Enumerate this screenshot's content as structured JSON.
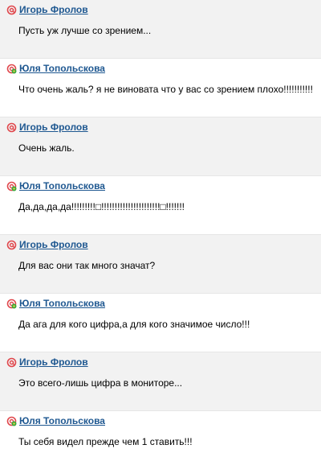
{
  "thread": {
    "messages": [
      {
        "author": "Игорь Фролов",
        "text": "Пусть уж лучше со зрением...",
        "status": "away-icon"
      },
      {
        "author": "Юля Топольскова",
        "text": "Что очень жаль? я не виновата что у вас со зрением плохо!!!!!!!!!!!",
        "status": "online-icon"
      },
      {
        "author": "Игорь Фролов",
        "text": "Очень жаль.",
        "status": "away-icon"
      },
      {
        "author": "Юля Топольскова",
        "text": "Да,да,да,да!!!!!!!!!□!!!!!!!!!!!!!!!!!!!!!!□!!!!!!!",
        "status": "online-icon"
      },
      {
        "author": "Игорь Фролов",
        "text": "Для вас они так много значат?",
        "status": "away-icon"
      },
      {
        "author": "Юля Топольскова",
        "text": "Да ага для кого цифра,а для кого значимое число!!!",
        "status": "online-icon"
      },
      {
        "author": "Игорь Фролов",
        "text": "Это всего-лишь цифра в мониторе...",
        "status": "away-icon"
      },
      {
        "author": "Юля Топольскова",
        "text": "Ты себя видел прежде чем 1 ставить!!!",
        "status": "online-icon"
      }
    ]
  },
  "colors": {
    "author_link": "#1f5891",
    "alt_row": "#f2f2f2",
    "away_at": "#e0474c",
    "online_at": "#e0474c",
    "online_flower": "#3aa83a"
  }
}
